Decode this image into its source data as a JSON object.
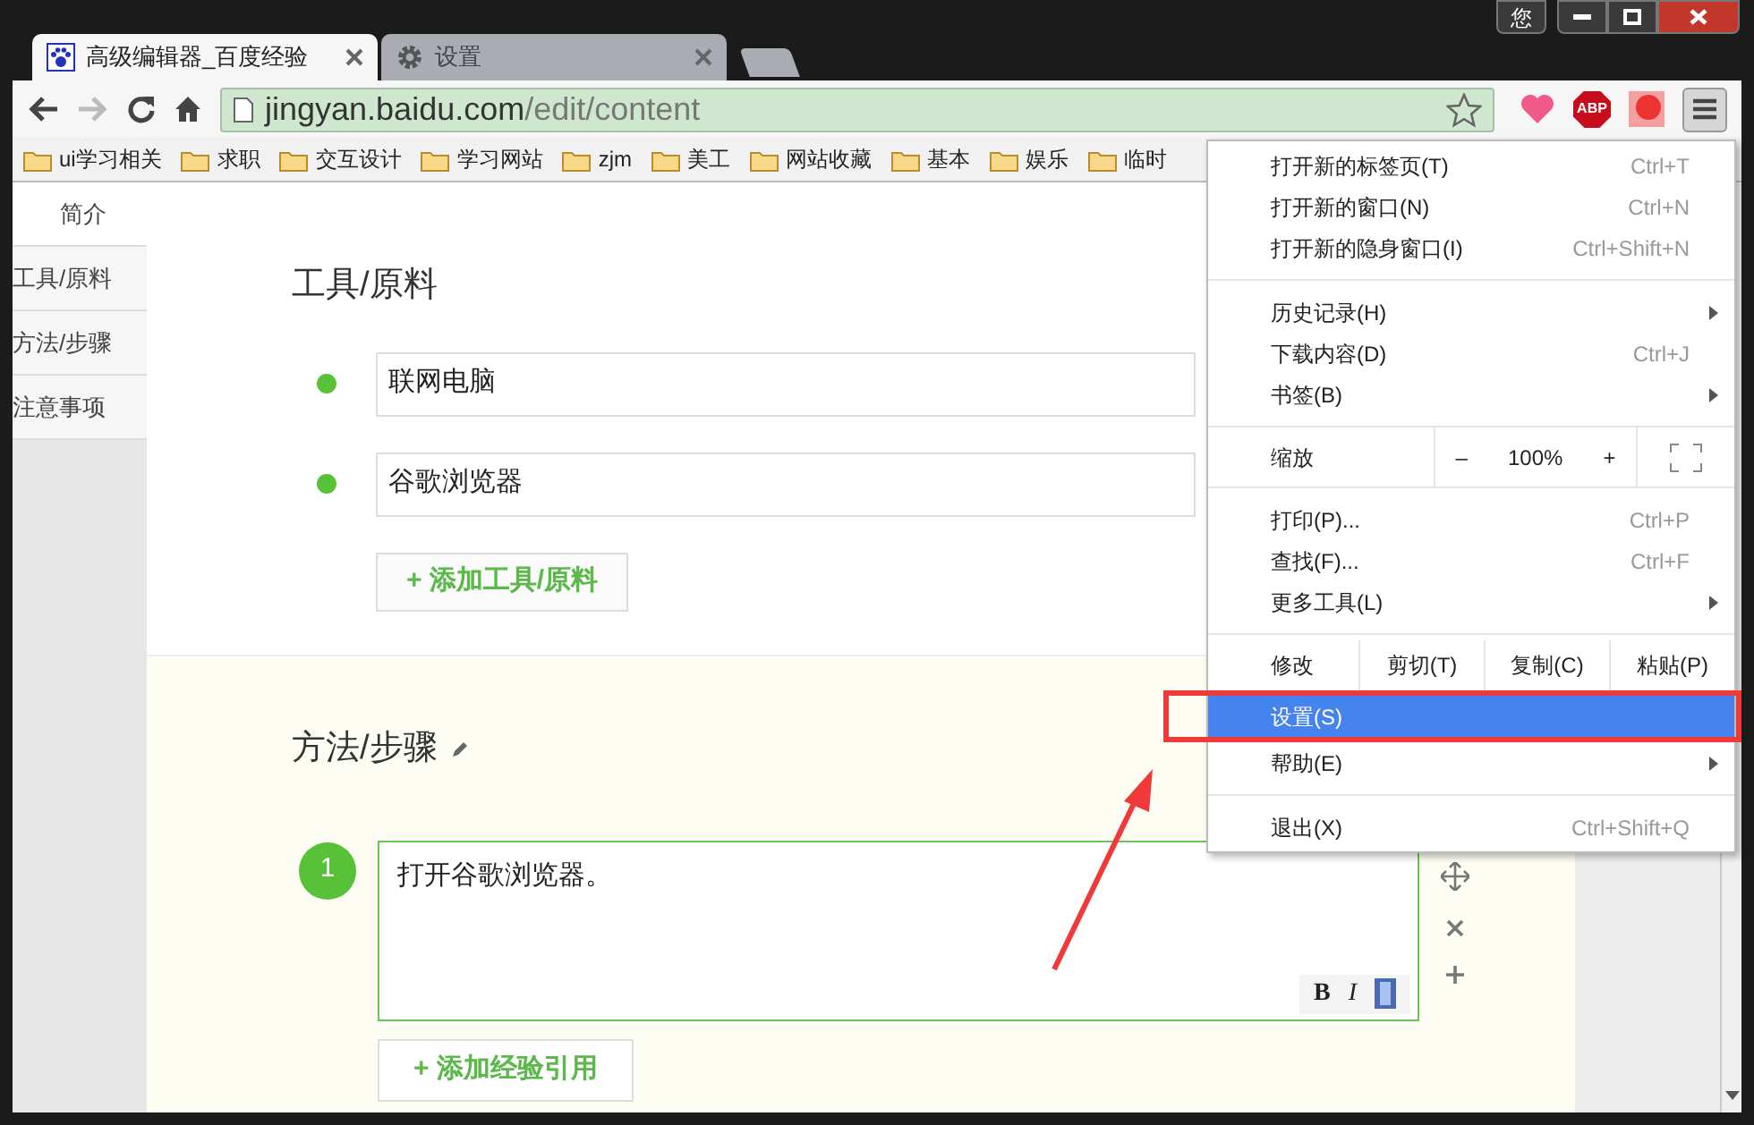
{
  "window": {
    "profile_button": "您"
  },
  "tabs": [
    {
      "title": "高级编辑器_百度经验",
      "selected": true
    },
    {
      "title": "设置",
      "selected": false
    }
  ],
  "extensions": {
    "adblock_label": "ABP"
  },
  "address_bar": {
    "host": "jingyan.baidu.com",
    "path": "/edit/content"
  },
  "bookmarks": [
    "ui学习相关",
    "求职",
    "交互设计",
    "学习网站",
    "zjm",
    "美工",
    "网站收藏",
    "基本",
    "娱乐",
    "临时"
  ],
  "sidebar": {
    "items": [
      {
        "label": "简介",
        "selected": true
      },
      {
        "label": "工具/原料",
        "selected": false
      },
      {
        "label": "方法/步骤",
        "selected": false
      },
      {
        "label": "注意事项",
        "selected": false
      }
    ]
  },
  "tools_section": {
    "title": "工具/原料",
    "items": [
      "联网电脑",
      "谷歌浏览器"
    ],
    "add_button": "+ 添加工具/原料"
  },
  "steps_section": {
    "title": "方法/步骤",
    "steps": [
      {
        "number": "1",
        "text": "打开谷歌浏览器。"
      }
    ],
    "format_buttons": [
      "B",
      "I"
    ],
    "add_button": "+ 添加经验引用"
  },
  "menu": {
    "items": [
      {
        "kind": "item",
        "label": "打开新的标签页(T)",
        "shortcut": "Ctrl+T",
        "submenu": false,
        "selected": false
      },
      {
        "kind": "item",
        "label": "打开新的窗口(N)",
        "shortcut": "Ctrl+N",
        "submenu": false,
        "selected": false
      },
      {
        "kind": "item",
        "label": "打开新的隐身窗口(I)",
        "shortcut": "Ctrl+Shift+N",
        "submenu": false,
        "selected": false
      },
      {
        "kind": "separator"
      },
      {
        "kind": "item",
        "label": "历史记录(H)",
        "submenu": true,
        "selected": false
      },
      {
        "kind": "item",
        "label": "下载内容(D)",
        "shortcut": "Ctrl+J",
        "submenu": false,
        "selected": false
      },
      {
        "kind": "item",
        "label": "书签(B)",
        "submenu": true,
        "selected": false
      },
      {
        "kind": "separator"
      },
      {
        "kind": "zoom",
        "label": "缩放",
        "minus": "–",
        "value": "100%",
        "plus": "+"
      },
      {
        "kind": "separator"
      },
      {
        "kind": "item",
        "label": "打印(P)...",
        "shortcut": "Ctrl+P",
        "submenu": false,
        "selected": false
      },
      {
        "kind": "item",
        "label": "查找(F)...",
        "shortcut": "Ctrl+F",
        "submenu": false,
        "selected": false
      },
      {
        "kind": "item",
        "label": "更多工具(L)",
        "submenu": true,
        "selected": false
      },
      {
        "kind": "separator"
      },
      {
        "kind": "edit",
        "label": "修改",
        "buttons": [
          "剪切(T)",
          "复制(C)",
          "粘贴(P)"
        ]
      },
      {
        "kind": "item",
        "label": "设置(S)",
        "submenu": false,
        "selected": true
      },
      {
        "kind": "item",
        "label": "帮助(E)",
        "submenu": true,
        "selected": false
      },
      {
        "kind": "separator"
      },
      {
        "kind": "item",
        "label": "退出(X)",
        "shortcut": "Ctrl+Shift+Q",
        "submenu": false,
        "selected": false
      }
    ]
  }
}
